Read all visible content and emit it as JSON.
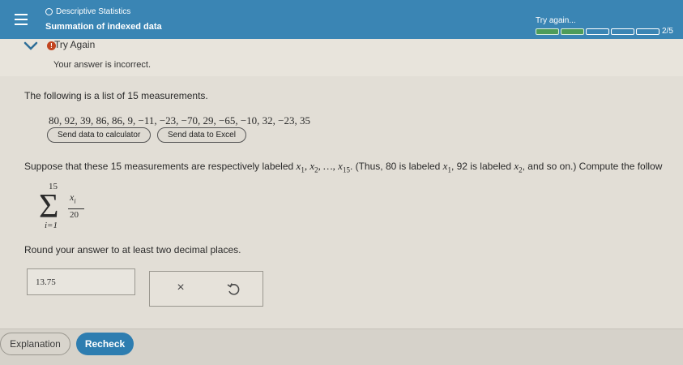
{
  "header": {
    "topic": "Descriptive Statistics",
    "title": "Summation of indexed data",
    "status_label": "Try again...",
    "progress": {
      "completed": 2,
      "total": 5,
      "label": "2/5"
    }
  },
  "feedback": {
    "heading": "Try Again",
    "message": "Your answer is incorrect."
  },
  "problem": {
    "intro": "The following is a list of 15 measurements.",
    "data_list": "80, 92, 39, 86, 86, 9, −11, −23, −70, 29, −65, −10, 32, −23, 35",
    "send_calculator_label": "Send data to calculator",
    "send_excel_label": "Send data to Excel",
    "question_part1": "Suppose that these 15 measurements are respectively labeled ",
    "question_part2": ". (Thus, 80 is labeled ",
    "question_part3": ", 92 is labeled ",
    "question_part4": ", and so on.) Compute the follow",
    "sum_upper": "15",
    "sum_lower": "i=1",
    "frac_numerator": "x",
    "frac_numerator_sub": "i",
    "frac_denominator": "20",
    "round_instruction": "Round your answer to at least two decimal places."
  },
  "answer": {
    "value": "13.75"
  },
  "tools": {
    "clear_symbol": "×"
  },
  "footer": {
    "explanation_label": "Explanation",
    "recheck_label": "Recheck"
  },
  "colors": {
    "header_bg": "#3a85b4",
    "progress_done": "#4c9c5a",
    "alert": "#c24520",
    "recheck_bg": "#2e7db0"
  }
}
